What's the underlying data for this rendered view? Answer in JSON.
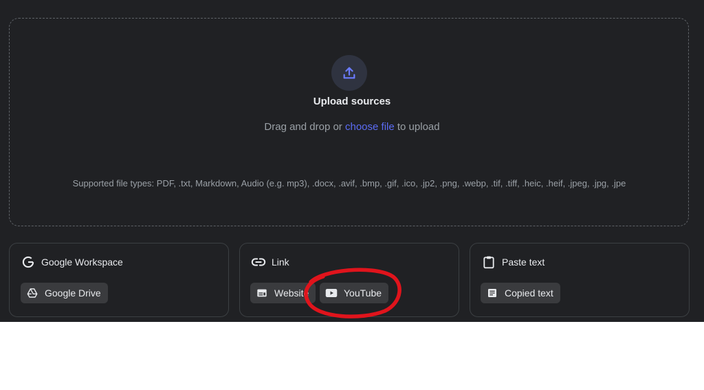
{
  "upload": {
    "title": "Upload sources",
    "prompt_before": "Drag and drop or ",
    "prompt_link": "choose file",
    "prompt_after": " to upload",
    "supported": "Supported file types: PDF, .txt, Markdown, Audio (e.g. mp3), .docx, .avif, .bmp, .gif, .ico, .jp2, .png, .webp, .tif, .tiff, .heic, .heif, .jpeg, .jpg, .jpe",
    "icon": "upload-icon"
  },
  "cards": {
    "workspace": {
      "title": "Google Workspace",
      "icon": "google-g-icon",
      "chips": [
        {
          "label": "Google Drive",
          "icon": "drive-icon"
        }
      ]
    },
    "link": {
      "title": "Link",
      "icon": "link-icon",
      "chips": [
        {
          "label": "Website",
          "icon": "website-icon"
        },
        {
          "label": "YouTube",
          "icon": "youtube-icon"
        }
      ]
    },
    "paste": {
      "title": "Paste text",
      "icon": "clipboard-icon",
      "chips": [
        {
          "label": "Copied text",
          "icon": "document-icon"
        }
      ]
    }
  },
  "colors": {
    "background": "#202124",
    "accent_link": "#5b6cf5",
    "upload_icon": "#6b7cff",
    "annotation": "#e0141c"
  }
}
